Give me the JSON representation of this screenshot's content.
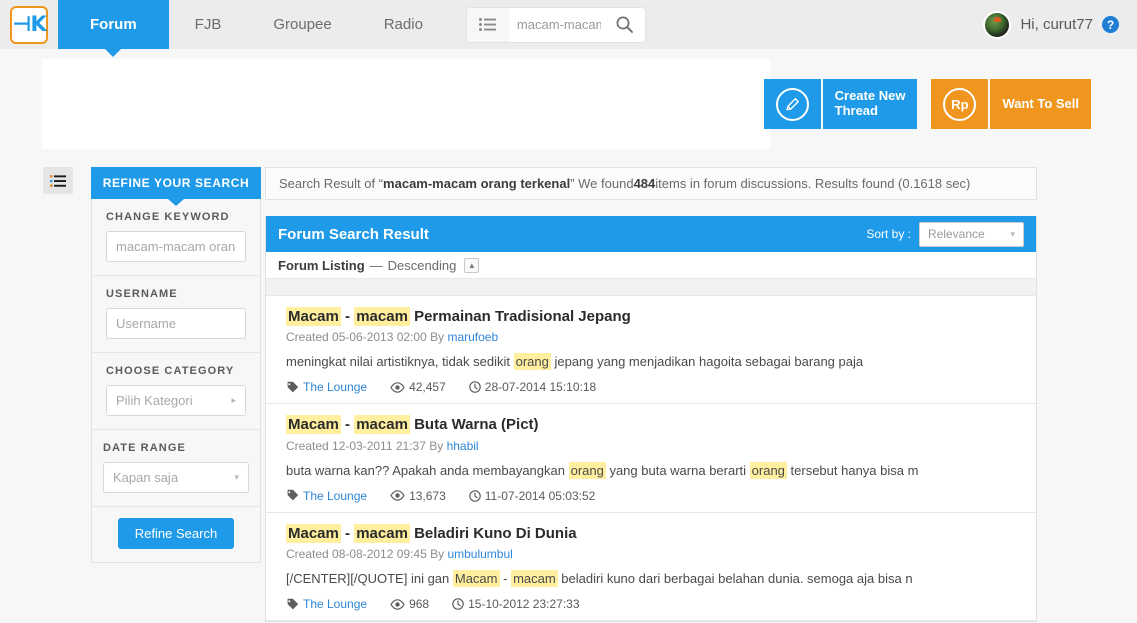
{
  "topnav": {
    "logo_alt": "kaskus-logo",
    "items": [
      {
        "label": "Forum",
        "active": true
      },
      {
        "label": "FJB",
        "active": false
      },
      {
        "label": "Groupee",
        "active": false
      },
      {
        "label": "Radio",
        "active": false
      }
    ],
    "search": {
      "placeholder": "macam-macam orang terkenal",
      "value": "",
      "list_icon": "list-icon",
      "search_icon": "search-icon"
    },
    "user": {
      "greeting": "Hi, curut77",
      "help_icon": "?"
    }
  },
  "actions": {
    "create_thread": {
      "label": "Create New\nThread",
      "icon": "pencil-icon",
      "color": "#1e9ae8"
    },
    "want_to_sell": {
      "label": "Want To Sell",
      "icon": "Rp",
      "color": "#f0961e"
    }
  },
  "sidebar": {
    "toggle_icon": "list-toggle-icon",
    "header": "REFINE YOUR SEARCH",
    "groups": [
      {
        "label": "CHANGE KEYWORD",
        "type": "input",
        "placeholder": "macam-macam orang terkenal",
        "value": ""
      },
      {
        "label": "USERNAME",
        "type": "input",
        "placeholder": "Username",
        "value": ""
      },
      {
        "label": "CHOOSE CATEGORY",
        "type": "select",
        "value": "Pilih Kategori",
        "arrow": "▸"
      },
      {
        "label": "DATE RANGE",
        "type": "select",
        "value": "Kapan saja",
        "arrow": "▾"
      }
    ],
    "submit_label": "Refine Search"
  },
  "result_info": {
    "prefix": "Search Result of “",
    "query": "macam-macam orang terkenal",
    "middle": "” We found ",
    "count": "484",
    "suffix": " items in forum discussions. Results found (0.1618 sec)"
  },
  "panel": {
    "title": "Forum Search Result",
    "sort_label": "Sort by :",
    "sort_value": "Relevance",
    "listing_label": "Forum Listing",
    "listing_dash": "—",
    "listing_order": "Descending",
    "collapse_icon": "chevron-up-icon"
  },
  "results": [
    {
      "title_parts": [
        {
          "text": "Macam",
          "hl": true
        },
        {
          "text": " - ",
          "hl": false
        },
        {
          "text": "macam",
          "hl": true
        },
        {
          "text": " Permainan Tradisional Jepang",
          "hl": false
        }
      ],
      "created_prefix": "Created 05-06-2013 02:00 By ",
      "author": "marufoeb",
      "snippet_parts": [
        {
          "text": "meningkat nilai artistiknya, tidak sedikit ",
          "hl": false
        },
        {
          "text": "orang",
          "hl": true
        },
        {
          "text": " jepang yang menjadikan hagoita sebagai barang paja",
          "hl": false
        }
      ],
      "forum": "The Lounge",
      "views": "42,457",
      "date": "28-07-2014 15:10:18"
    },
    {
      "title_parts": [
        {
          "text": "Macam",
          "hl": true
        },
        {
          "text": "  -  ",
          "hl": false
        },
        {
          "text": "macam",
          "hl": true
        },
        {
          "text": " Buta Warna (Pict)",
          "hl": false
        }
      ],
      "created_prefix": "Created 12-03-2011 21:37 By ",
      "author": "hhabil",
      "snippet_parts": [
        {
          "text": "buta warna kan?? Apakah anda membayangkan ",
          "hl": false
        },
        {
          "text": "orang",
          "hl": true
        },
        {
          "text": " yang buta warna berarti ",
          "hl": false
        },
        {
          "text": "orang",
          "hl": true
        },
        {
          "text": " tersebut hanya bisa m",
          "hl": false
        }
      ],
      "forum": "The Lounge",
      "views": "13,673",
      "date": "11-07-2014 05:03:52"
    },
    {
      "title_parts": [
        {
          "text": "Macam",
          "hl": true
        },
        {
          "text": " - ",
          "hl": false
        },
        {
          "text": "macam",
          "hl": true
        },
        {
          "text": " Beladiri Kuno Di Dunia",
          "hl": false
        }
      ],
      "created_prefix": "Created 08-08-2012 09:45 By ",
      "author": "umbulumbul",
      "snippet_parts": [
        {
          "text": "[/CENTER][/QUOTE] ini gan ",
          "hl": false
        },
        {
          "text": "Macam",
          "hl": true
        },
        {
          "text": " - ",
          "hl": false
        },
        {
          "text": "macam",
          "hl": true
        },
        {
          "text": " beladiri kuno dari berbagai belahan dunia. semoga aja bisa n",
          "hl": false
        }
      ],
      "forum": "The Lounge",
      "views": "968",
      "date": "15-10-2012 23:27:33"
    }
  ],
  "icons": {
    "tag": "tag-icon",
    "eye": "eye-icon",
    "clock": "clock-icon"
  },
  "colors": {
    "brand_blue": "#1e9ae8",
    "brand_orange": "#f0961e",
    "highlight": "#ffef9e",
    "link": "#2e86d6"
  }
}
